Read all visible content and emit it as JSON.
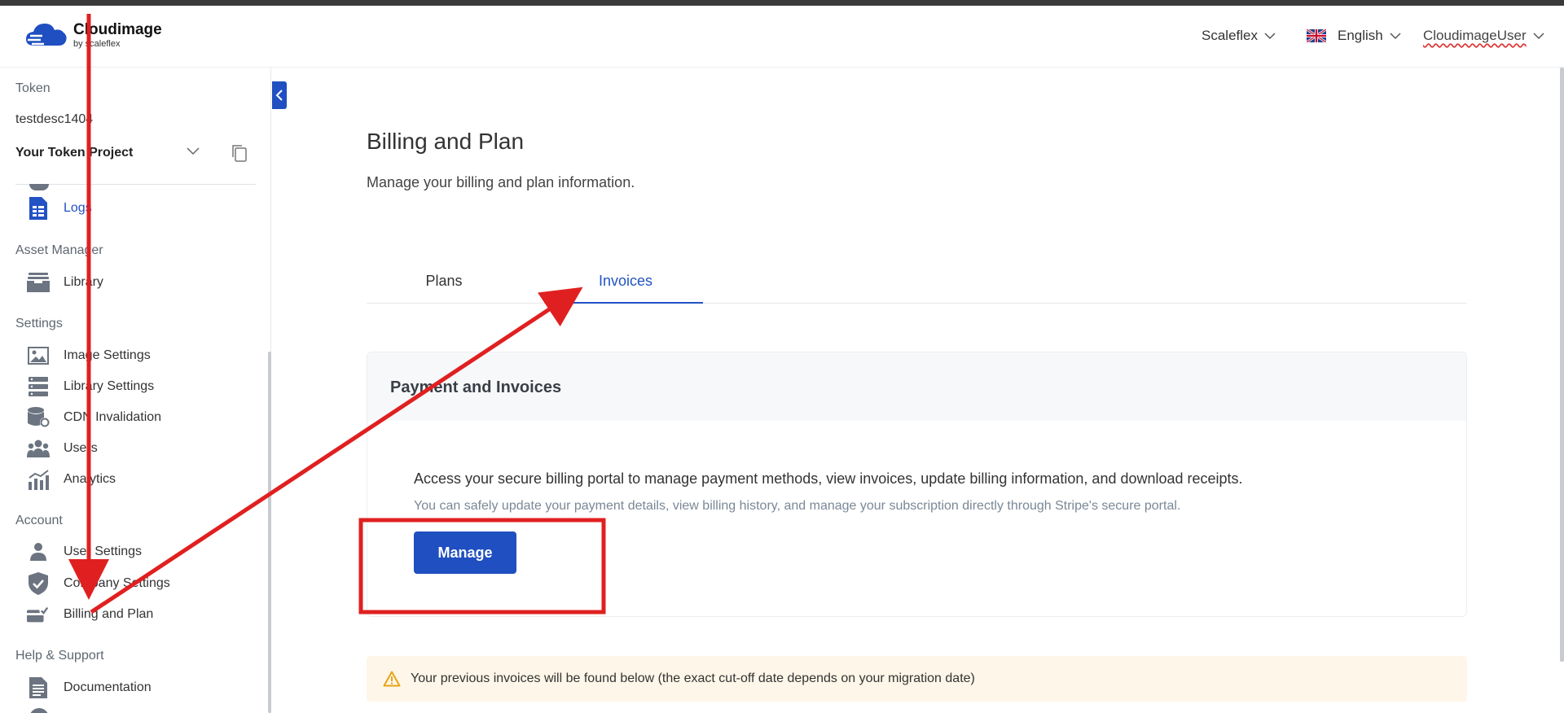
{
  "header": {
    "logo_name": "Cloudimage",
    "logo_by": "by scaleflex",
    "company": "Scaleflex",
    "language": "English",
    "user": "CloudimageUser"
  },
  "sidebar": {
    "token_label": "Token",
    "token_value": "testdesc1404",
    "project": "Your Token Project",
    "logs": "Logs",
    "asset_manager": "Asset Manager",
    "library": "Library",
    "settings": "Settings",
    "image_settings": "Image Settings",
    "library_settings": "Library Settings",
    "cdn_invalidation": "CDN Invalidation",
    "users": "Users",
    "analytics": "Analytics",
    "account": "Account",
    "user_settings": "User Settings",
    "company_settings": "Company Settings",
    "billing_and_plan": "Billing and Plan",
    "help_support": "Help & Support",
    "documentation": "Documentation"
  },
  "main": {
    "title": "Billing and Plan",
    "subtitle": "Manage your billing and plan information.",
    "tabs": [
      {
        "label": "Plans"
      },
      {
        "label": "Invoices"
      }
    ],
    "card": {
      "heading": "Payment and Invoices",
      "text": "Access your secure billing portal to manage payment methods, view invoices, update billing information, and download receipts.",
      "subtext": "You can safely update your payment details, view billing history, and manage your subscription directly through Stripe's secure portal.",
      "button": "Manage"
    },
    "warning": "Your previous invoices will be found below (the exact cut-off date depends on your migration date)"
  },
  "colors": {
    "accent": "#1f4fc0",
    "annotation": "#e02020",
    "warning_bg": "#fef6e8"
  }
}
